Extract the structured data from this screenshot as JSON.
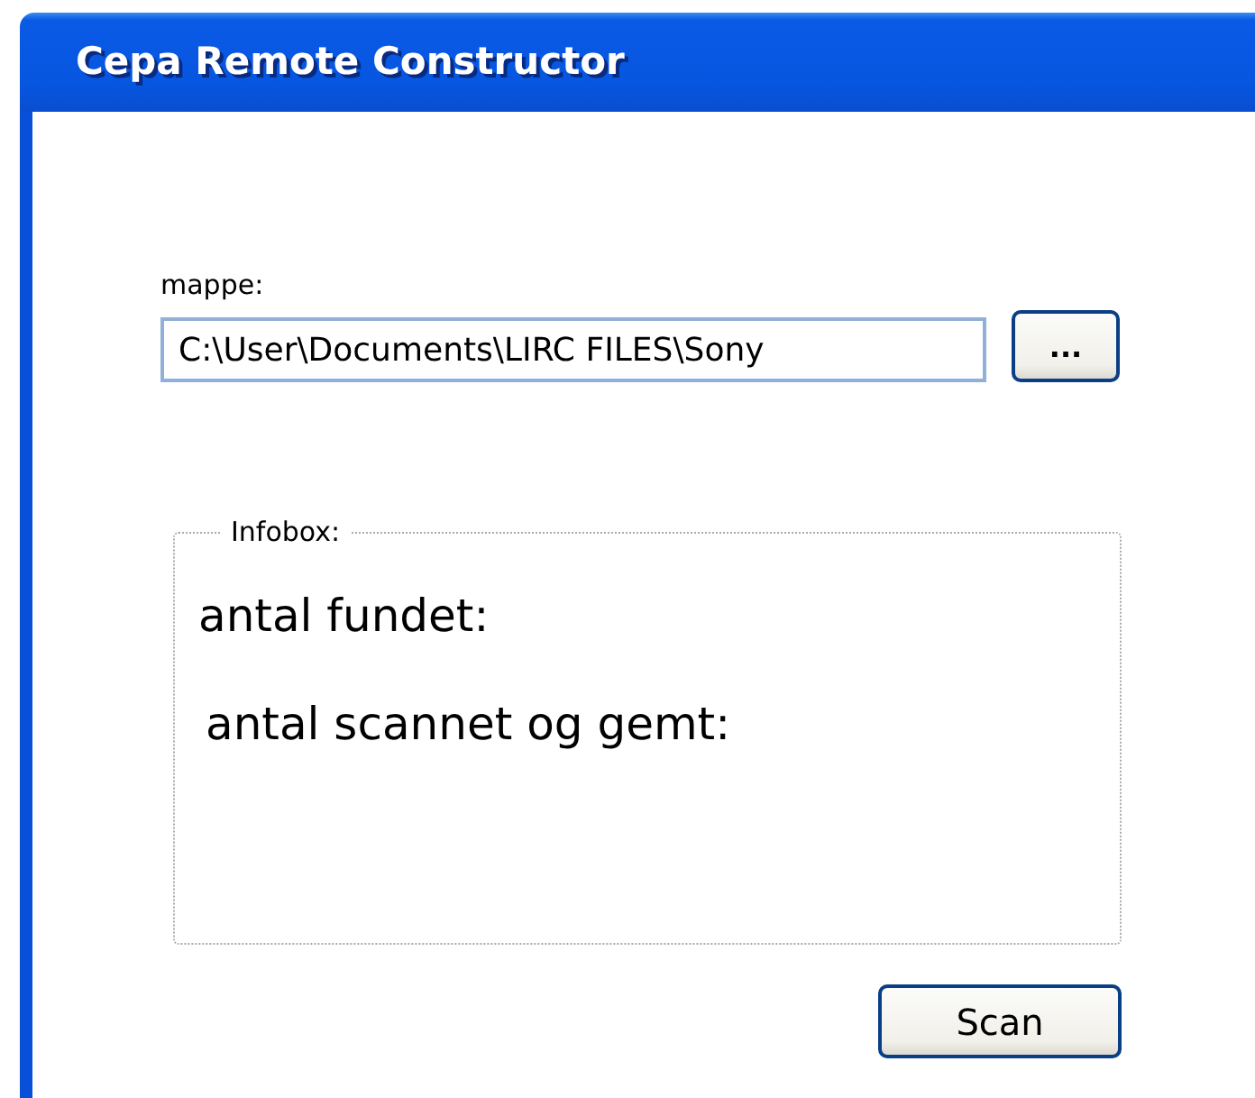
{
  "window": {
    "title": "Cepa Remote Constructor"
  },
  "folder": {
    "label": "mappe:",
    "value": "C:\\User\\Documents\\LIRC FILES\\Sony"
  },
  "browse_button": "...",
  "infobox": {
    "legend": "Infobox:",
    "lines": [
      "antal fundet:",
      "antal scannet og gemt:"
    ]
  },
  "scan_button": "Scan"
}
